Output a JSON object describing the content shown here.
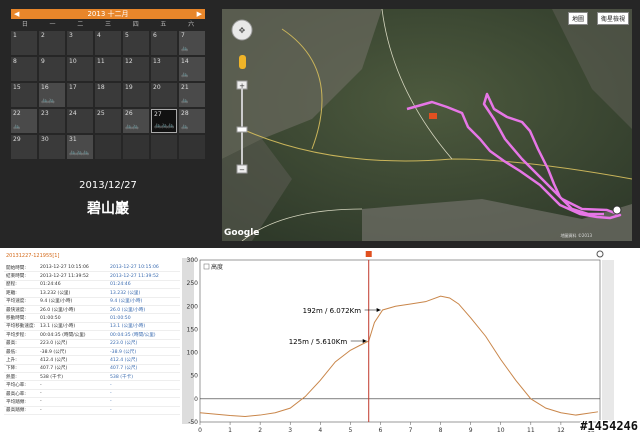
{
  "calendar": {
    "month_title": "2013 十二月",
    "weekdays": [
      "日",
      "一",
      "二",
      "三",
      "四",
      "五",
      "六"
    ],
    "days": [
      {
        "num": "1",
        "bikes": ""
      },
      {
        "num": "2",
        "bikes": ""
      },
      {
        "num": "3",
        "bikes": ""
      },
      {
        "num": "4",
        "bikes": ""
      },
      {
        "num": "5",
        "bikes": ""
      },
      {
        "num": "6",
        "bikes": ""
      },
      {
        "num": "7",
        "bikes": "🚲"
      },
      {
        "num": "8",
        "bikes": ""
      },
      {
        "num": "9",
        "bikes": ""
      },
      {
        "num": "10",
        "bikes": ""
      },
      {
        "num": "11",
        "bikes": ""
      },
      {
        "num": "12",
        "bikes": ""
      },
      {
        "num": "13",
        "bikes": ""
      },
      {
        "num": "14",
        "bikes": "🚲"
      },
      {
        "num": "15",
        "bikes": ""
      },
      {
        "num": "16",
        "bikes": "🚲🚲"
      },
      {
        "num": "17",
        "bikes": ""
      },
      {
        "num": "18",
        "bikes": ""
      },
      {
        "num": "19",
        "bikes": ""
      },
      {
        "num": "20",
        "bikes": ""
      },
      {
        "num": "21",
        "bikes": "🚲"
      },
      {
        "num": "22",
        "bikes": "🚲"
      },
      {
        "num": "23",
        "bikes": ""
      },
      {
        "num": "24",
        "bikes": ""
      },
      {
        "num": "25",
        "bikes": ""
      },
      {
        "num": "26",
        "bikes": "🚲🚲"
      },
      {
        "num": "27",
        "bikes": "🚲🚲🚲"
      },
      {
        "num": "28",
        "bikes": "🚲"
      },
      {
        "num": "29",
        "bikes": ""
      },
      {
        "num": "30",
        "bikes": ""
      },
      {
        "num": "31",
        "bikes": "🚲🚲🚲"
      }
    ],
    "selected_day": "27"
  },
  "selected": {
    "date": "2013/12/27",
    "place": "碧山巖"
  },
  "map": {
    "buttons": [
      "地圖",
      "衛星檢視"
    ],
    "logo": "Google",
    "copyright": "地圖資料 ©2013"
  },
  "stats": {
    "title": "20131227-121955[1]",
    "rows": [
      {
        "label": "開始時間:",
        "v1": "2013-12-27 10:15:06",
        "v2": "2013-12-27 10:15:06"
      },
      {
        "label": "結束時間:",
        "v1": "2013-12-27 11:39:52",
        "v2": "2013-12-27 11:39:52"
      },
      {
        "label": "歷程:",
        "v1": "01:24:46",
        "v2": "01:24:46"
      },
      {
        "label": "距離:",
        "v1": "13.232 (公里)",
        "v2": "13.232 (公里)"
      },
      {
        "label": "平均速度:",
        "v1": "9.4 (公里/小時)",
        "v2": "9.4 (公里/小時)"
      },
      {
        "label": "最快速度:",
        "v1": "26.0 (公里/小時)",
        "v2": "26.0 (公里/小時)"
      },
      {
        "label": "移動時間:",
        "v1": "01:00:50",
        "v2": "01:00:50"
      },
      {
        "label": "平均移動速度:",
        "v1": "13.1 (公里/小時)",
        "v2": "13.1 (公里/小時)"
      },
      {
        "label": "平均步程:",
        "v1": "00:04:35 (時間/公里)",
        "v2": "00:04:35 (時間/公里)"
      },
      {
        "label": "最高:",
        "v1": "223.0 (公尺)",
        "v2": "223.0 (公尺)"
      },
      {
        "label": "最低:",
        "v1": "-38.9 (公尺)",
        "v2": "-38.9 (公尺)"
      },
      {
        "label": "上升:",
        "v1": "412.4 (公尺)",
        "v2": "412.4 (公尺)"
      },
      {
        "label": "下降:",
        "v1": "407.7 (公尺)",
        "v2": "407.7 (公尺)"
      },
      {
        "label": "熱量:",
        "v1": "538 (千卡)",
        "v2": "538 (千卡)"
      },
      {
        "label": "平均心率:",
        "v1": "-",
        "v2": "-"
      },
      {
        "label": "最高心率:",
        "v1": "-",
        "v2": "-"
      },
      {
        "label": "平均踏頻:",
        "v1": "-",
        "v2": "-"
      },
      {
        "label": "最高踏頻:",
        "v1": "-",
        "v2": "-"
      }
    ]
  },
  "chart_data": {
    "type": "line",
    "series": [
      {
        "name": "高度",
        "x": [
          0,
          0.5,
          1,
          1.5,
          2,
          2.5,
          3,
          3.5,
          4,
          4.5,
          5,
          5.3,
          5.61,
          5.8,
          6.072,
          6.5,
          7,
          7.5,
          8,
          8.3,
          8.6,
          9,
          9.5,
          10,
          10.5,
          11,
          11.5,
          12,
          12.5,
          13.232
        ],
        "values": [
          -30,
          -33,
          -36,
          -38,
          -35,
          -30,
          -20,
          5,
          40,
          80,
          105,
          115,
          125,
          165,
          192,
          200,
          205,
          210,
          222,
          218,
          205,
          175,
          135,
          85,
          40,
          0,
          -20,
          -30,
          -35,
          -28
        ]
      }
    ],
    "xlim": [
      0,
      13.3
    ],
    "ylim": [
      -50,
      300
    ],
    "xticks": [
      "0",
      "1",
      "2",
      "3",
      "4",
      "5",
      "6",
      "7",
      "8",
      "9",
      "10",
      "11",
      "12",
      "13"
    ],
    "yticks": [
      "300",
      "250",
      "200",
      "150",
      "100",
      "50",
      "0",
      "-50"
    ],
    "annotations": [
      {
        "label": "192m / 6.072Km",
        "x": 6.072,
        "y": 192
      },
      {
        "label": "125m / 5.610Km",
        "x": 5.61,
        "y": 125
      }
    ],
    "cursor_x": 5.61,
    "grid": false,
    "legend": "top-left"
  },
  "watermark": "#1454246"
}
